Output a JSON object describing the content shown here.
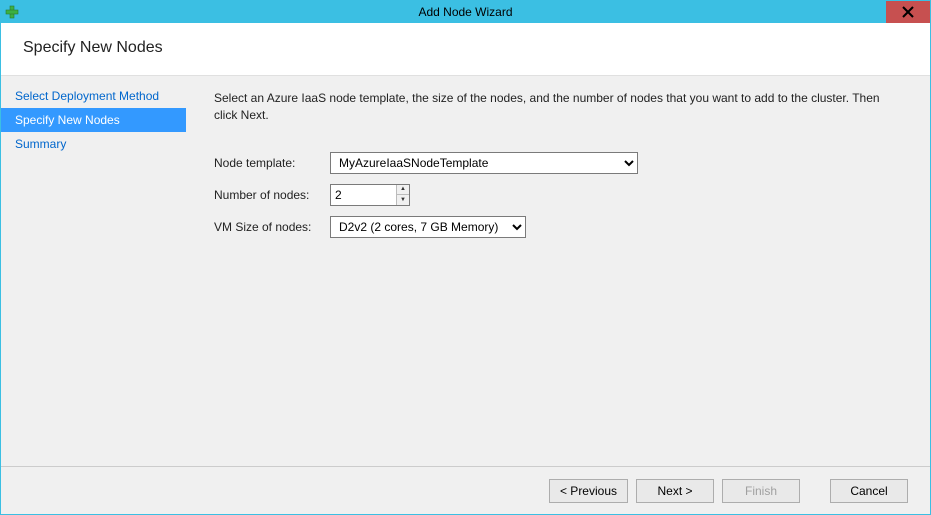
{
  "window": {
    "title": "Add Node Wizard"
  },
  "header": {
    "title": "Specify New Nodes"
  },
  "sidebar": {
    "items": [
      {
        "label": "Select Deployment Method"
      },
      {
        "label": "Specify New Nodes"
      },
      {
        "label": "Summary"
      }
    ]
  },
  "content": {
    "instruction": "Select an Azure IaaS node template, the size of the nodes, and the number of nodes that you want to add to the cluster. Then click Next.",
    "labels": {
      "template": "Node template:",
      "count": "Number of nodes:",
      "vmsize": "VM Size of nodes:"
    },
    "values": {
      "template": "MyAzureIaaSNodeTemplate",
      "count": "2",
      "vmsize": "D2v2 (2 cores, 7 GB Memory)"
    }
  },
  "footer": {
    "previous": "< Previous",
    "next": "Next >",
    "finish": "Finish",
    "cancel": "Cancel"
  }
}
